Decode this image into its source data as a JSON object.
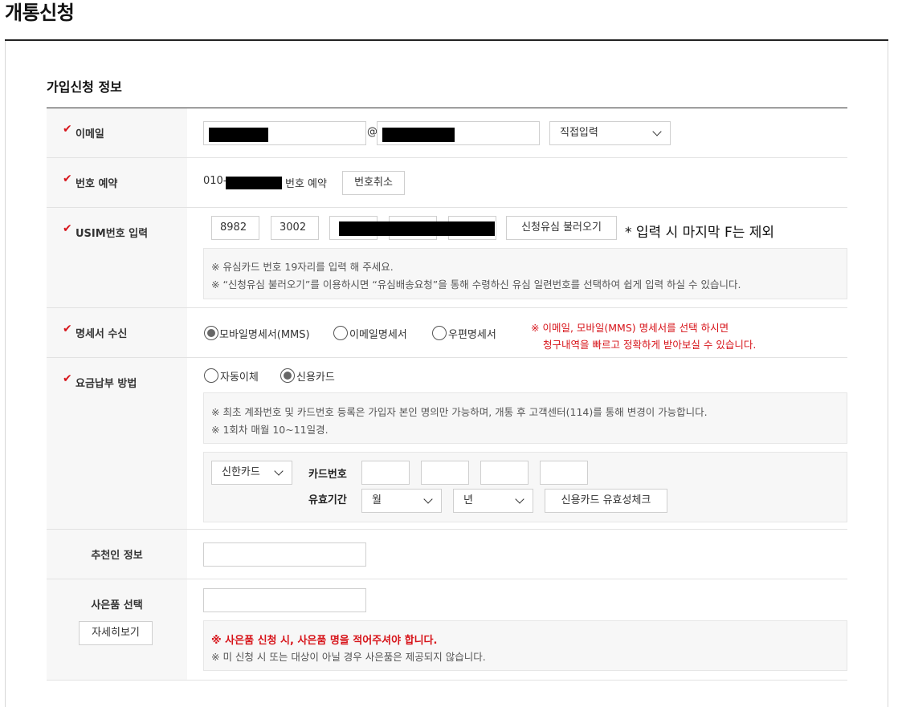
{
  "page_title": "개통신청",
  "section_title": "가입신청 정보",
  "check_mark": "✔",
  "email": {
    "label": "이메일",
    "at": "@",
    "domain_select": "직접입력"
  },
  "number_reserve": {
    "label": "번호 예약",
    "prefix": "010-",
    "suffix": "번호 예약",
    "cancel_button": "번호취소"
  },
  "usim": {
    "label": "USIM번호 입력",
    "fields": [
      "8982",
      "3002",
      "",
      "",
      ""
    ],
    "load_button": "신청유심 불러오기",
    "hint": "* 입력 시 마지막 F는 제외",
    "notes": [
      "※ 유심카드 번호 19자리를 입력 해 주세요.",
      "※ “신청유심 불러오기”를 이용하시면 “유심배송요청”을 통해 수령하신 유심 일련번호를 선택하여 쉽게 입력 하실 수 있습니다."
    ]
  },
  "statement": {
    "label": "명세서 수신",
    "options": [
      "모바일명세서(MMS)",
      "이메일명세서",
      "우편명세서"
    ],
    "selected": 0,
    "notice_line1": "※ 이메일, 모바일(MMS) 명세서를 선택 하시면",
    "notice_line2": "청구내역을 빠르고 정확하게 받아보실 수 있습니다."
  },
  "payment": {
    "label": "요금납부 방법",
    "options": [
      "자동이체",
      "신용카드"
    ],
    "selected": 1,
    "notes": [
      "※ 최초 계좌번호 및 카드번호 등록은 가입자 본인 명의만 가능하며, 개통 후 고객센터(114)를 통해 변경이 가능합니다.",
      "※ 1회차 매월 10~11일경."
    ],
    "card_select": "신한카드",
    "card_number_label": "카드번호",
    "expiry_label": "유효기간",
    "month_select": "월",
    "year_select": "년",
    "validate_button": "신용카드 유효성체크"
  },
  "referrer": {
    "label": "추천인 정보"
  },
  "gift": {
    "label": "사은품 선택",
    "detail_button": "자세히보기",
    "note_red": "※ 사은품 신청 시, 사은품 명을 적어주셔야 합니다.",
    "note": "※ 미 신청 시 또는 대상이 아닐 경우 사은품은 제공되지 않습니다."
  },
  "colors": {
    "accent_red": "#d7141a",
    "label_bg": "#f7f7f7"
  }
}
